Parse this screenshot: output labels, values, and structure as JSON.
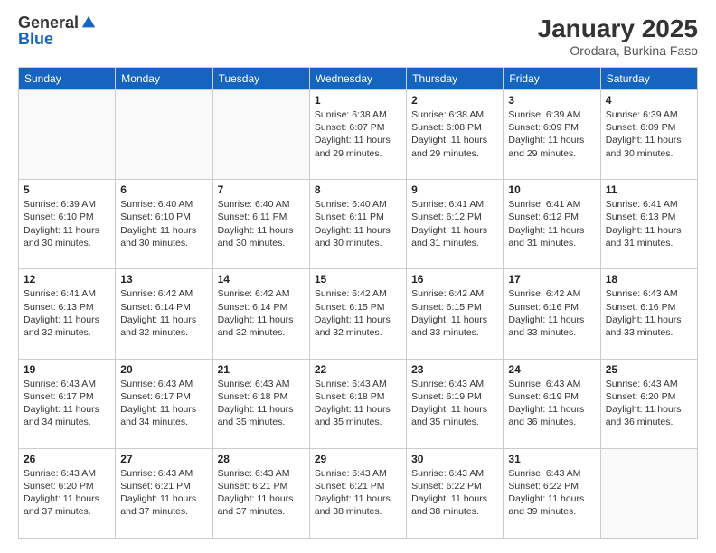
{
  "header": {
    "logo_general": "General",
    "logo_blue": "Blue",
    "month_title": "January 2025",
    "location": "Orodara, Burkina Faso"
  },
  "weekdays": [
    "Sunday",
    "Monday",
    "Tuesday",
    "Wednesday",
    "Thursday",
    "Friday",
    "Saturday"
  ],
  "weeks": [
    [
      {
        "day": "",
        "info": ""
      },
      {
        "day": "",
        "info": ""
      },
      {
        "day": "",
        "info": ""
      },
      {
        "day": "1",
        "info": "Sunrise: 6:38 AM\nSunset: 6:07 PM\nDaylight: 11 hours and 29 minutes."
      },
      {
        "day": "2",
        "info": "Sunrise: 6:38 AM\nSunset: 6:08 PM\nDaylight: 11 hours and 29 minutes."
      },
      {
        "day": "3",
        "info": "Sunrise: 6:39 AM\nSunset: 6:09 PM\nDaylight: 11 hours and 29 minutes."
      },
      {
        "day": "4",
        "info": "Sunrise: 6:39 AM\nSunset: 6:09 PM\nDaylight: 11 hours and 30 minutes."
      }
    ],
    [
      {
        "day": "5",
        "info": "Sunrise: 6:39 AM\nSunset: 6:10 PM\nDaylight: 11 hours and 30 minutes."
      },
      {
        "day": "6",
        "info": "Sunrise: 6:40 AM\nSunset: 6:10 PM\nDaylight: 11 hours and 30 minutes."
      },
      {
        "day": "7",
        "info": "Sunrise: 6:40 AM\nSunset: 6:11 PM\nDaylight: 11 hours and 30 minutes."
      },
      {
        "day": "8",
        "info": "Sunrise: 6:40 AM\nSunset: 6:11 PM\nDaylight: 11 hours and 30 minutes."
      },
      {
        "day": "9",
        "info": "Sunrise: 6:41 AM\nSunset: 6:12 PM\nDaylight: 11 hours and 31 minutes."
      },
      {
        "day": "10",
        "info": "Sunrise: 6:41 AM\nSunset: 6:12 PM\nDaylight: 11 hours and 31 minutes."
      },
      {
        "day": "11",
        "info": "Sunrise: 6:41 AM\nSunset: 6:13 PM\nDaylight: 11 hours and 31 minutes."
      }
    ],
    [
      {
        "day": "12",
        "info": "Sunrise: 6:41 AM\nSunset: 6:13 PM\nDaylight: 11 hours and 32 minutes."
      },
      {
        "day": "13",
        "info": "Sunrise: 6:42 AM\nSunset: 6:14 PM\nDaylight: 11 hours and 32 minutes."
      },
      {
        "day": "14",
        "info": "Sunrise: 6:42 AM\nSunset: 6:14 PM\nDaylight: 11 hours and 32 minutes."
      },
      {
        "day": "15",
        "info": "Sunrise: 6:42 AM\nSunset: 6:15 PM\nDaylight: 11 hours and 32 minutes."
      },
      {
        "day": "16",
        "info": "Sunrise: 6:42 AM\nSunset: 6:15 PM\nDaylight: 11 hours and 33 minutes."
      },
      {
        "day": "17",
        "info": "Sunrise: 6:42 AM\nSunset: 6:16 PM\nDaylight: 11 hours and 33 minutes."
      },
      {
        "day": "18",
        "info": "Sunrise: 6:43 AM\nSunset: 6:16 PM\nDaylight: 11 hours and 33 minutes."
      }
    ],
    [
      {
        "day": "19",
        "info": "Sunrise: 6:43 AM\nSunset: 6:17 PM\nDaylight: 11 hours and 34 minutes."
      },
      {
        "day": "20",
        "info": "Sunrise: 6:43 AM\nSunset: 6:17 PM\nDaylight: 11 hours and 34 minutes."
      },
      {
        "day": "21",
        "info": "Sunrise: 6:43 AM\nSunset: 6:18 PM\nDaylight: 11 hours and 35 minutes."
      },
      {
        "day": "22",
        "info": "Sunrise: 6:43 AM\nSunset: 6:18 PM\nDaylight: 11 hours and 35 minutes."
      },
      {
        "day": "23",
        "info": "Sunrise: 6:43 AM\nSunset: 6:19 PM\nDaylight: 11 hours and 35 minutes."
      },
      {
        "day": "24",
        "info": "Sunrise: 6:43 AM\nSunset: 6:19 PM\nDaylight: 11 hours and 36 minutes."
      },
      {
        "day": "25",
        "info": "Sunrise: 6:43 AM\nSunset: 6:20 PM\nDaylight: 11 hours and 36 minutes."
      }
    ],
    [
      {
        "day": "26",
        "info": "Sunrise: 6:43 AM\nSunset: 6:20 PM\nDaylight: 11 hours and 37 minutes."
      },
      {
        "day": "27",
        "info": "Sunrise: 6:43 AM\nSunset: 6:21 PM\nDaylight: 11 hours and 37 minutes."
      },
      {
        "day": "28",
        "info": "Sunrise: 6:43 AM\nSunset: 6:21 PM\nDaylight: 11 hours and 37 minutes."
      },
      {
        "day": "29",
        "info": "Sunrise: 6:43 AM\nSunset: 6:21 PM\nDaylight: 11 hours and 38 minutes."
      },
      {
        "day": "30",
        "info": "Sunrise: 6:43 AM\nSunset: 6:22 PM\nDaylight: 11 hours and 38 minutes."
      },
      {
        "day": "31",
        "info": "Sunrise: 6:43 AM\nSunset: 6:22 PM\nDaylight: 11 hours and 39 minutes."
      },
      {
        "day": "",
        "info": ""
      }
    ]
  ]
}
